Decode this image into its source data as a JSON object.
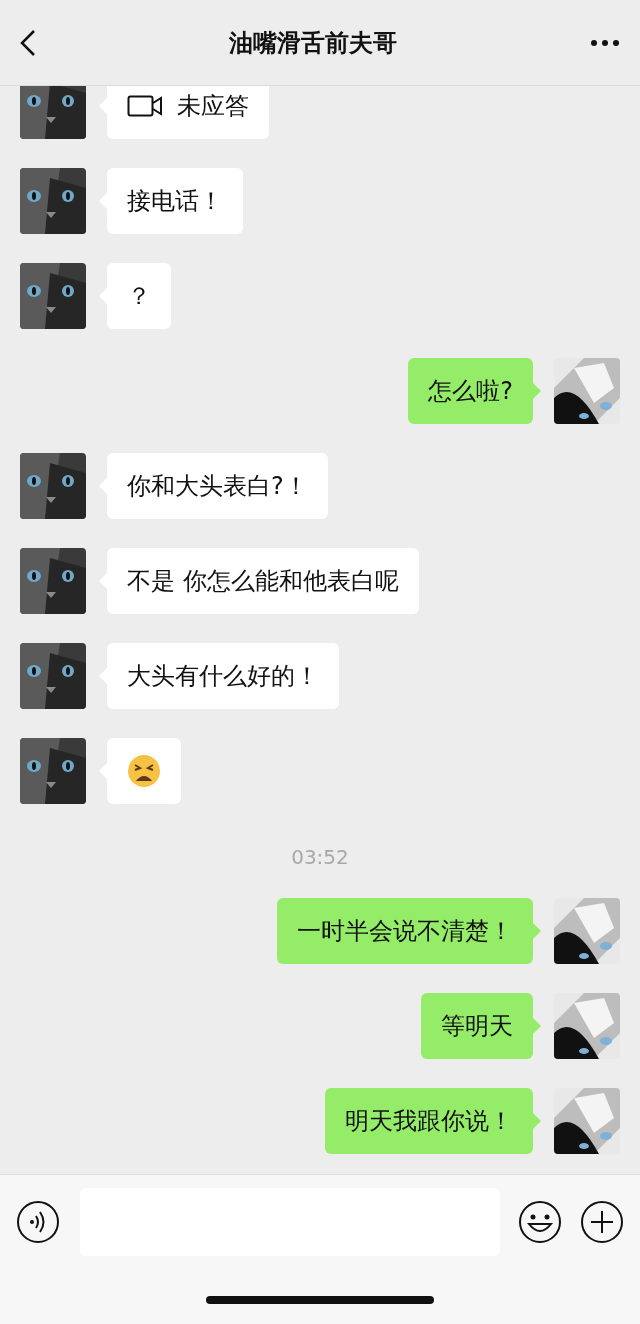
{
  "header": {
    "title": "油嘴滑舌前夫哥"
  },
  "messages": [
    {
      "kind": "call",
      "outgoing": false,
      "text": "未应答"
    },
    {
      "kind": "text",
      "outgoing": false,
      "text": "接电话！"
    },
    {
      "kind": "text",
      "outgoing": false,
      "text": "？"
    },
    {
      "kind": "text",
      "outgoing": true,
      "text": "怎么啦?"
    },
    {
      "kind": "text",
      "outgoing": false,
      "text": "你和大头表白?！"
    },
    {
      "kind": "text",
      "outgoing": false,
      "text": "不是 你怎么能和他表白呢"
    },
    {
      "kind": "text",
      "outgoing": false,
      "text": "大头有什么好的！"
    },
    {
      "kind": "emoji",
      "outgoing": false
    },
    {
      "kind": "time",
      "text": "03:52"
    },
    {
      "kind": "text",
      "outgoing": true,
      "text": "一时半会说不清楚！"
    },
    {
      "kind": "text",
      "outgoing": true,
      "text": "等明天"
    },
    {
      "kind": "text",
      "outgoing": true,
      "text": "明天我跟你说！"
    }
  ]
}
